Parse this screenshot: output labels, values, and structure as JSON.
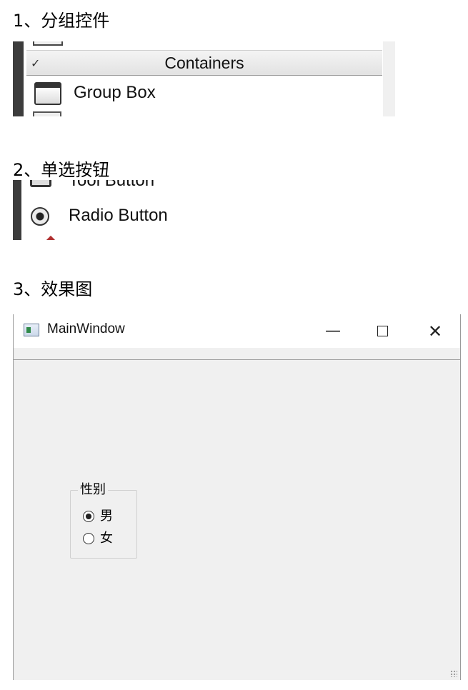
{
  "headings": [
    "1、分组控件",
    "2、单选按钮",
    "3、效果图"
  ],
  "widget_box": {
    "category": "Containers",
    "groupbox_item": "Group Box",
    "toolbutton_item": "Tool Button",
    "radiobutton_item": "Radio Button"
  },
  "window": {
    "title": "MainWindow",
    "minimize": "—",
    "close": "✕",
    "groupbox": {
      "title": "性别",
      "options": [
        {
          "label": "男",
          "checked": true
        },
        {
          "label": "女",
          "checked": false
        }
      ]
    }
  }
}
